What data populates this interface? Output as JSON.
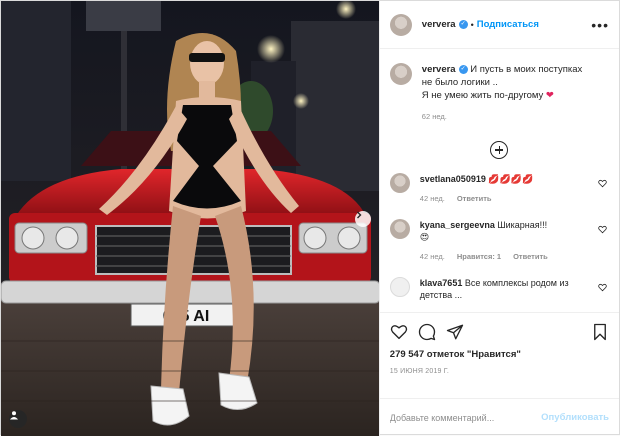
{
  "header": {
    "username": "ververa",
    "separator": "•",
    "follow_label": "Подписаться",
    "more_label": "•••"
  },
  "caption": {
    "username": "ververa",
    "text_line1": "И пусть в моих поступках",
    "text_line2": "не было логики ..",
    "text_line3": "Я не умею жить по-другому",
    "emoji": "❤",
    "time": "62 нед."
  },
  "comments": [
    {
      "username": "svetlana050919",
      "text": "💋💋💋💋",
      "time": "42 нед.",
      "reply_label": "Ответить"
    },
    {
      "username": "kyana_sergeevna",
      "text": "Шикарная!!!",
      "emoji": "😍",
      "time": "42 нед.",
      "likes_label": "Нравится: 1",
      "reply_label": "Ответить"
    },
    {
      "username": "klava7651",
      "text": "Все комплексы родом из детства ...",
      "time": "",
      "reply_label": ""
    }
  ],
  "actions": {
    "likes_text": "279 547 отметок \"Нравится\"",
    "date": "15 ИЮНЯ 2019 Г."
  },
  "add_comment": {
    "placeholder": "Добавьте комментарий...",
    "publish_label": "Опубликовать"
  },
  "photo": {
    "plate_text": "005 AI"
  },
  "colors": {
    "accent": "#0095f6",
    "verified": "#3897f0",
    "car_red": "#c8161d",
    "publish_disabled": "#b2dffc"
  }
}
